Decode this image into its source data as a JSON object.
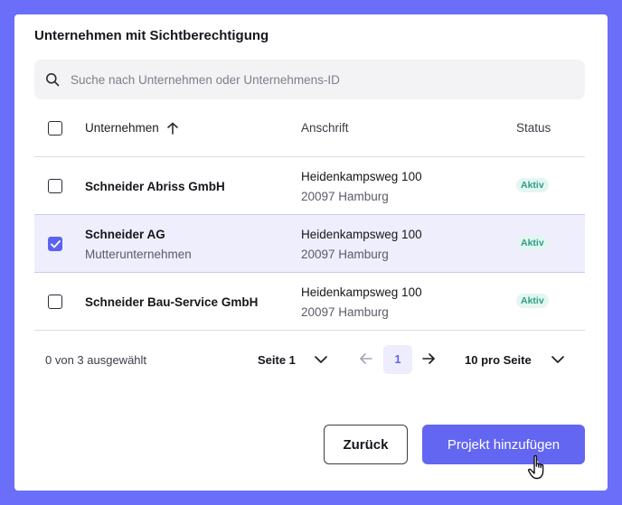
{
  "dialog": {
    "title": "Unternehmen mit Sichtberechtigung"
  },
  "search": {
    "placeholder": "Suche nach Unternehmen oder Unternehmens-ID",
    "value": ""
  },
  "table": {
    "columns": {
      "company": "Unternehmen",
      "address": "Anschrift",
      "status": "Status"
    },
    "sort": {
      "column": "company",
      "direction": "ascending",
      "icon": "arrow-up-icon"
    },
    "rows": [
      {
        "name": "Schneider Abriss GmbH",
        "subtitle": "",
        "street": "Heidenkampsweg 100",
        "city": "20097 Hamburg",
        "status": "Aktiv",
        "checked": false
      },
      {
        "name": "Schneider AG",
        "subtitle": "Mutterunternehmen",
        "street": "Heidenkampsweg 100",
        "city": "20097 Hamburg",
        "status": "Aktiv",
        "checked": true
      },
      {
        "name": "Schneider Bau-Service GmbH",
        "subtitle": "",
        "street": "Heidenkampsweg 100",
        "city": "20097 Hamburg",
        "status": "Aktiv",
        "checked": false
      }
    ]
  },
  "pagination": {
    "selection_summary": "0 von 3 ausgewählt",
    "page_label": "Seite 1",
    "current_page": "1",
    "per_page_label": "10 pro Seite"
  },
  "actions": {
    "back_label": "Zurück",
    "add_label": "Projekt hinzufügen"
  },
  "colors": {
    "backdrop": "#6b6ef8",
    "accent": "#6366f1",
    "status_active_bg": "#e3f6f1",
    "status_active_text": "#2d9f83",
    "selected_row_bg": "#eeeefd"
  }
}
